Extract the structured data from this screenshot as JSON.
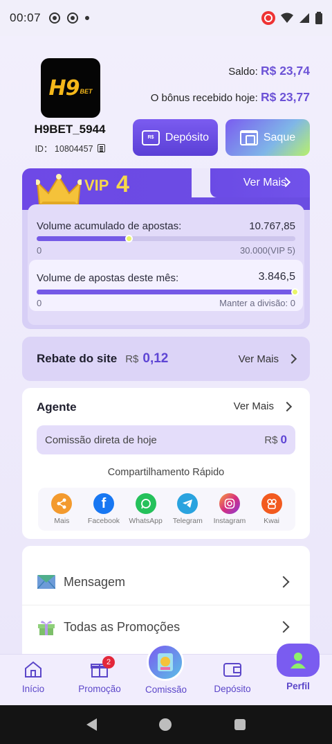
{
  "status_bar": {
    "time": "00:07"
  },
  "header": {
    "logo_text": "H9",
    "logo_sub": "BET",
    "username": "H9BET_5944",
    "user_id": "ID： 10804457",
    "saldo_label": "Saldo:",
    "saldo_value": "R$ 23,74",
    "bonus_label": "O bônus recebido hoje:",
    "bonus_value": "R$ 23,77",
    "deposit_button": "Depósito",
    "withdraw_button": "Saque",
    "wallet_icon_text": "R$"
  },
  "vip": {
    "label": "VIP",
    "level": "4",
    "more": "Ver Mais",
    "accumulated_label": "Volume acumulado de apostas:",
    "accumulated_value": "10.767,85",
    "accumulated_min": "0",
    "accumulated_target": "30.000(VIP 5)",
    "accumulated_progress": 0.359,
    "month_label": "Volume de apostas deste mês:",
    "month_value": "3.846,5",
    "month_min": "0",
    "month_keep": "Manter a divisão: 0",
    "month_progress": 1.0
  },
  "rebate": {
    "title": "Rebate do site",
    "currency": "R$",
    "value": "0,12",
    "more": "Ver Mais"
  },
  "agente": {
    "title": "Agente",
    "more": "Ver Mais",
    "commission_label": "Comissão direta de hoje",
    "commission_currency": "R$",
    "commission_value": "0",
    "share_title": "Compartilhamento Rápido",
    "share_items": [
      {
        "label": "Mais",
        "icon": "share-icon",
        "color": "#f39a2e"
      },
      {
        "label": "Facebook",
        "icon": "facebook-icon",
        "color": "#1877f2"
      },
      {
        "label": "WhatsApp",
        "icon": "whatsapp-icon",
        "color": "#25c15b"
      },
      {
        "label": "Telegram",
        "icon": "telegram-icon",
        "color": "#2aa3df"
      },
      {
        "label": "Instagram",
        "icon": "instagram-icon",
        "color": "#d6307e"
      },
      {
        "label": "Kwai",
        "icon": "kwai-icon",
        "color": "#f25a1f"
      }
    ]
  },
  "menu": [
    {
      "label": "Mensagem",
      "icon": "envelope-icon"
    },
    {
      "label": "Todas as Promoções",
      "icon": "gift-icon"
    }
  ],
  "bottom_nav": {
    "items": [
      {
        "label": "Início",
        "icon": "home-icon"
      },
      {
        "label": "Promoção",
        "icon": "gift-icon",
        "badge": "2"
      },
      {
        "label": "Comissão",
        "icon": "commission-icon"
      },
      {
        "label": "Depósito",
        "icon": "wallet-icon"
      },
      {
        "label": "Perfil",
        "icon": "user-icon"
      }
    ]
  },
  "colors": {
    "accent": "#6c52d6",
    "vip_gold": "#f6d84a",
    "badge": "#e3273a"
  }
}
